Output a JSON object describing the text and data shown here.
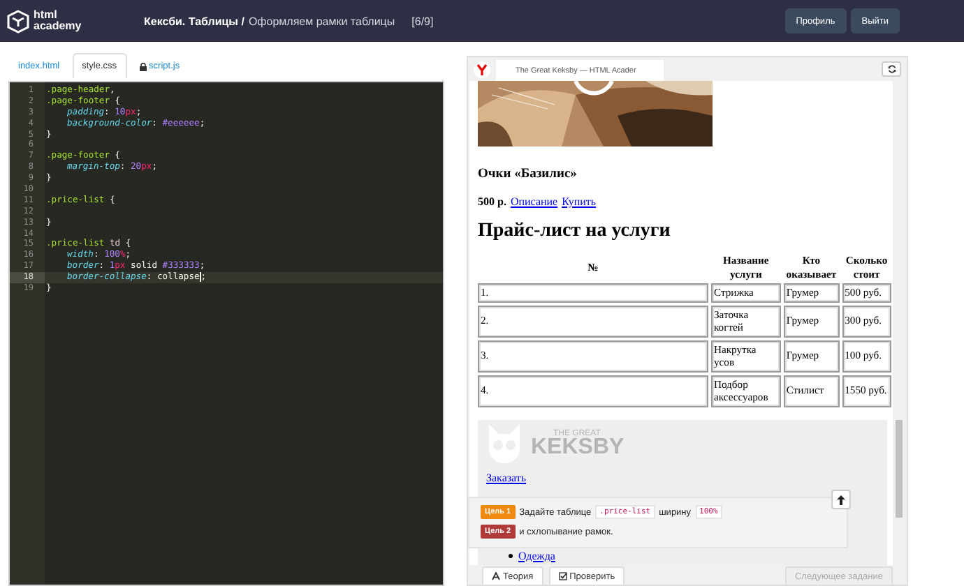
{
  "header": {
    "logo_lines": [
      "html",
      "academy"
    ],
    "course": "Кексби. Таблицы /",
    "lesson": "Оформляем рамки таблицы",
    "progress": "[6/9]",
    "buttons": [
      "Профиль",
      "Выйти"
    ]
  },
  "file_tabs": [
    {
      "label": "index.html",
      "selected": false,
      "locked": false
    },
    {
      "label": "style.css",
      "selected": true,
      "locked": false
    },
    {
      "label": "script.js",
      "selected": false,
      "locked": true
    }
  ],
  "editor": {
    "lines": [
      {
        "number": "1",
        "selected": false,
        "tokens": [
          {
            "kind": "selector",
            "text": ".page-header"
          },
          {
            "kind": "punct",
            "text": ","
          }
        ]
      },
      {
        "number": "2",
        "selected": false,
        "tokens": [
          {
            "kind": "selector",
            "text": ".page-footer"
          },
          {
            "kind": "punct",
            "text": " {"
          }
        ]
      },
      {
        "number": "3",
        "selected": false,
        "indent": true,
        "tokens": [
          {
            "kind": "property",
            "text": "padding"
          },
          {
            "kind": "punct",
            "text": ": "
          },
          {
            "kind": "number",
            "text": "10"
          },
          {
            "kind": "unit",
            "text": "px"
          },
          {
            "kind": "punct",
            "text": ";"
          }
        ]
      },
      {
        "number": "4",
        "selected": false,
        "indent": true,
        "tokens": [
          {
            "kind": "property",
            "text": "background-color"
          },
          {
            "kind": "punct",
            "text": ": "
          },
          {
            "kind": "number",
            "text": "#eeeeee"
          },
          {
            "kind": "punct",
            "text": ";"
          }
        ]
      },
      {
        "number": "5",
        "selected": false,
        "tokens": [
          {
            "kind": "punct",
            "text": "}"
          }
        ]
      },
      {
        "number": "6",
        "selected": false
      },
      {
        "number": "7",
        "selected": false,
        "tokens": [
          {
            "kind": "selector",
            "text": ".page-footer"
          },
          {
            "kind": "punct",
            "text": " {"
          }
        ]
      },
      {
        "number": "8",
        "selected": false,
        "indent": true,
        "tokens": [
          {
            "kind": "property",
            "text": "margin-top"
          },
          {
            "kind": "punct",
            "text": ": "
          },
          {
            "kind": "number",
            "text": "20"
          },
          {
            "kind": "unit",
            "text": "px"
          },
          {
            "kind": "punct",
            "text": ";"
          }
        ]
      },
      {
        "number": "9",
        "selected": false,
        "tokens": [
          {
            "kind": "punct",
            "text": "}"
          }
        ]
      },
      {
        "number": "10",
        "selected": false
      },
      {
        "number": "11",
        "selected": false,
        "tokens": [
          {
            "kind": "selector",
            "text": ".price-list"
          },
          {
            "kind": "punct",
            "text": " {"
          }
        ]
      },
      {
        "number": "12",
        "selected": false
      },
      {
        "number": "13",
        "selected": false,
        "tokens": [
          {
            "kind": "punct",
            "text": "}"
          }
        ]
      },
      {
        "number": "14",
        "selected": false
      },
      {
        "number": "15",
        "selected": false,
        "tokens": [
          {
            "kind": "selector",
            "text": ".price-list"
          },
          {
            "kind": "tag",
            "text": "td"
          },
          {
            "kind": "punct",
            "text": " {"
          }
        ]
      },
      {
        "number": "16",
        "selected": false,
        "indent": true,
        "tokens": [
          {
            "kind": "property",
            "text": "width"
          },
          {
            "kind": "punct",
            "text": ": "
          },
          {
            "kind": "number",
            "text": "100"
          },
          {
            "kind": "unit",
            "text": "%"
          },
          {
            "kind": "punct",
            "text": ";"
          }
        ]
      },
      {
        "number": "17",
        "selected": false,
        "indent": true,
        "tokens": [
          {
            "kind": "property",
            "text": "border"
          },
          {
            "kind": "punct",
            "text": ": "
          },
          {
            "kind": "number",
            "text": "1"
          },
          {
            "kind": "unit",
            "text": "px"
          },
          {
            "kind": "punct",
            "text": " solid "
          },
          {
            "kind": "number",
            "text": "#333333"
          },
          {
            "kind": "punct",
            "text": ";"
          }
        ]
      },
      {
        "number": "18",
        "selected": true,
        "indent": true,
        "tokens": [
          {
            "kind": "property",
            "text": "border-collapse"
          },
          {
            "kind": "punct",
            "text": ": collapse"
          },
          {
            "kind": "cursor"
          },
          {
            "kind": "punct",
            "text": ";"
          }
        ]
      },
      {
        "number": "19",
        "selected": false,
        "tokens": [
          {
            "kind": "punct",
            "text": "}"
          }
        ]
      }
    ]
  },
  "preview": {
    "tab_title": "The Great Keksby — HTML Acader",
    "product_title": "Очки «Базилис»",
    "price": "500 р.",
    "links": [
      "Описание",
      "Купить"
    ],
    "price_heading": "Прайс-лист на услуги",
    "table": {
      "columns": [
        "№",
        "Название услуги",
        "Кто оказывает",
        "Сколько стоит"
      ],
      "rows": [
        [
          "1.",
          "Стрижка",
          "Грумер",
          "500 руб."
        ],
        [
          "2.",
          "Заточка когтей",
          "Грумер",
          "300 руб."
        ],
        [
          "3.",
          "Накрутка усов",
          "Грумер",
          "100 руб."
        ],
        [
          "4.",
          "Подбор аксессуаров",
          "Стилист",
          "1550 руб."
        ]
      ]
    },
    "footer": {
      "logo_lines": [
        "THE GREAT",
        "KEKSBY"
      ],
      "order_link": "Заказать",
      "menu": [
        "Одежда"
      ]
    }
  },
  "tasks": [
    {
      "label": "Цель 1",
      "color": "#f0890f",
      "parts": [
        {
          "kind": "text",
          "text": "Задайте таблице"
        },
        {
          "kind": "code",
          "text": ".price-list"
        },
        {
          "kind": "text",
          "text": "ширину"
        },
        {
          "kind": "code",
          "text": "100%"
        }
      ]
    },
    {
      "label": "Цель 2",
      "color": "#b03a3a",
      "parts": [
        {
          "kind": "text",
          "text": "и схлопывание рамок."
        }
      ]
    }
  ],
  "actions": [
    {
      "label": "Теория",
      "kind": "theory",
      "disabled": false
    },
    {
      "label": "Проверить",
      "kind": "check",
      "disabled": false
    },
    {
      "label": "Следующее задание",
      "kind": "next",
      "disabled": true
    }
  ]
}
